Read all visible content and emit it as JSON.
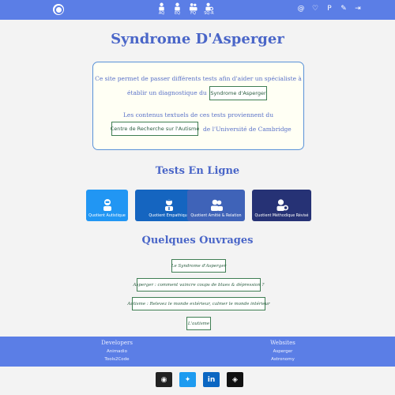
{
  "navbar": {
    "logo_icon": "brain-logo-icon",
    "tests": [
      {
        "label": "AQ",
        "icon": "robot-person-icon"
      },
      {
        "label": "EQ",
        "icon": "empathy-person-icon"
      },
      {
        "label": "FQ",
        "icon": "friends-icon"
      },
      {
        "label": "SQ-R",
        "icon": "gear-person-icon"
      }
    ],
    "right_icons": [
      {
        "name": "at-icon",
        "glyph": "@"
      },
      {
        "name": "heart-icon",
        "glyph": "♡"
      },
      {
        "name": "paypal-icon",
        "glyph": "P"
      },
      {
        "name": "edit-icon",
        "glyph": "✎"
      },
      {
        "name": "login-icon",
        "glyph": "⇥"
      }
    ]
  },
  "page_title": "Syndrome D'Asperger",
  "intro": {
    "line1": "Ce site permet de passer différents tests afin d'aider un spécialiste à",
    "line2_prefix": "établir un diagnostique du",
    "link_syndrome": "Syndrome d'Asperger",
    "line3": "Les contenus textuels de ces tests proviennent du",
    "link_centre": "Centre de Recherche sur l'Autisme",
    "line4_suffix": "de l'Université de Cambridge"
  },
  "tests_title": "Tests En Ligne",
  "tests": [
    {
      "label": "Quotient Autistique",
      "color": "#2196f3",
      "icon": "robot-icon"
    },
    {
      "label": "Quotient Empathique",
      "color": "#1565c0",
      "icon": "doctor-icon"
    },
    {
      "label": "Quotient Amitié & Relation",
      "color": "#3f63b8",
      "icon": "users-icon"
    },
    {
      "label": "Quotient Méthodique Révisé",
      "color": "#263275",
      "icon": "user-gear-icon"
    }
  ],
  "books_title": "Quelques Ouvrages",
  "books": [
    "Le Syndrome d'Asperger",
    "Asperger : comment vaincre coups de blues & dépression ?",
    "Autisme : Relevez le monde extérieur, calmer le monde intérieur",
    "L'autisme"
  ],
  "footer": {
    "developers_title": "Developers",
    "developers": [
      "Animadio",
      "Tools2Code"
    ],
    "websites_title": "Websites",
    "websites": [
      "Asperger",
      "Astronomy"
    ]
  },
  "socials": [
    {
      "name": "github-icon",
      "glyph": "◉",
      "color": "#222222"
    },
    {
      "name": "twitter-icon",
      "glyph": "✦",
      "color": "#1d9bf0"
    },
    {
      "name": "linkedin-icon",
      "glyph": "in",
      "color": "#0a66c2"
    },
    {
      "name": "codepen-icon",
      "glyph": "◈",
      "color": "#111111"
    }
  ]
}
